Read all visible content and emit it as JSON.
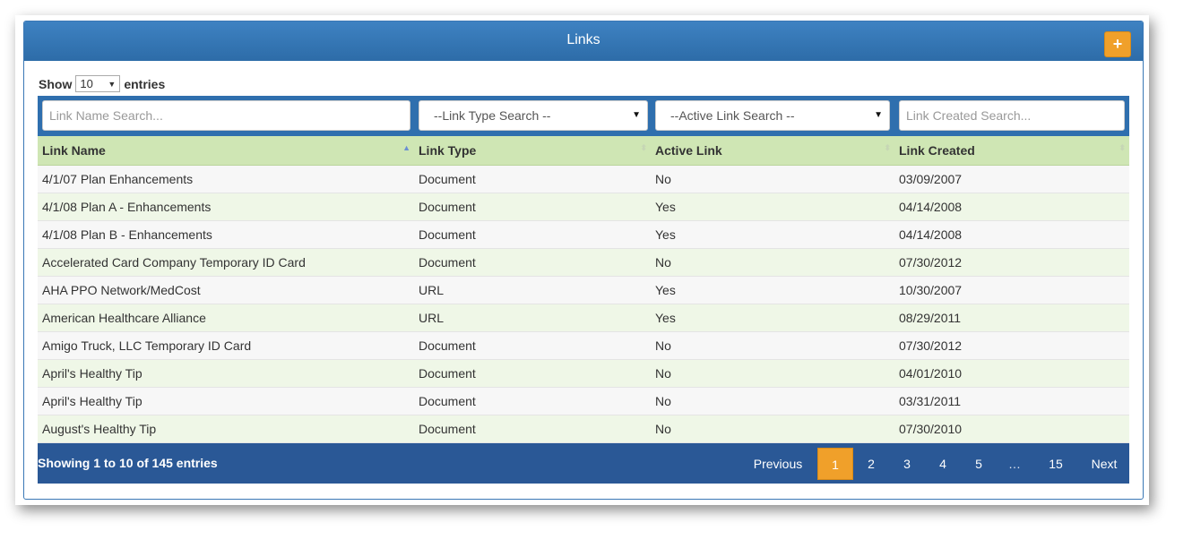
{
  "panel": {
    "title": "Links",
    "add_label": "+"
  },
  "length_menu": {
    "show_label": "Show",
    "selected": "10",
    "entries_label": "entries"
  },
  "search": {
    "link_name_placeholder": "Link Name Search...",
    "link_type_value": "--Link Type Search --",
    "active_link_value": "--Active Link Search --",
    "link_created_placeholder": "Link Created Search..."
  },
  "table": {
    "columns": [
      "Link Name",
      "Link Type",
      "Active Link",
      "Link Created"
    ],
    "rows": [
      [
        "4/1/07 Plan Enhancements",
        "Document",
        "No",
        "03/09/2007"
      ],
      [
        "4/1/08 Plan A - Enhancements",
        "Document",
        "Yes",
        "04/14/2008"
      ],
      [
        "4/1/08 Plan B - Enhancements",
        "Document",
        "Yes",
        "04/14/2008"
      ],
      [
        "Accelerated Card Company Temporary ID Card",
        "Document",
        "No",
        "07/30/2012"
      ],
      [
        "AHA PPO Network/MedCost",
        "URL",
        "Yes",
        "10/30/2007"
      ],
      [
        "American Healthcare Alliance",
        "URL",
        "Yes",
        "08/29/2011"
      ],
      [
        "Amigo Truck, LLC Temporary ID Card",
        "Document",
        "No",
        "07/30/2012"
      ],
      [
        "April's Healthy Tip",
        "Document",
        "No",
        "04/01/2010"
      ],
      [
        "April's Healthy Tip",
        "Document",
        "No",
        "03/31/2011"
      ],
      [
        "August's Healthy Tip",
        "Document",
        "No",
        "07/30/2010"
      ]
    ]
  },
  "footer": {
    "info": "Showing 1 to 10 of 145 entries",
    "previous": "Previous",
    "pages": [
      "1",
      "2",
      "3",
      "4",
      "5",
      "…",
      "15"
    ],
    "current_page": "1",
    "next": "Next"
  },
  "colors": {
    "header": "#2f6fae",
    "accent": "#f0a02a",
    "footer": "#2a5896",
    "table_head": "#cfe6b4"
  }
}
